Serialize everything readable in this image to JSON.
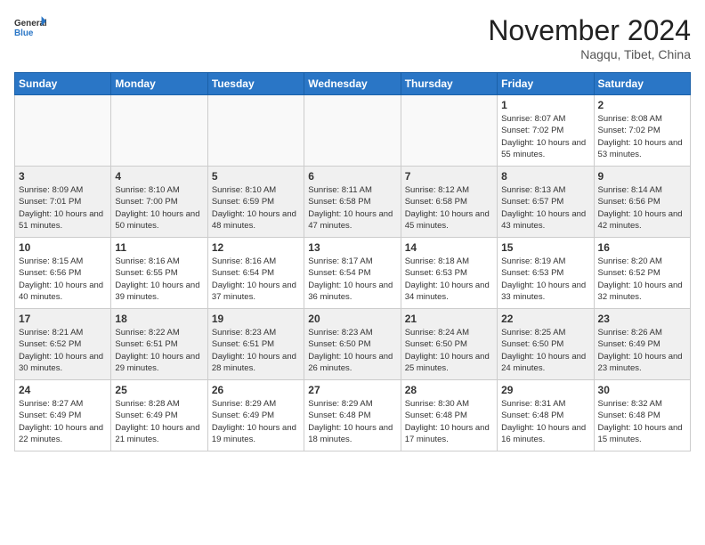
{
  "header": {
    "logo_general": "General",
    "logo_blue": "Blue",
    "month_title": "November 2024",
    "location": "Nagqu, Tibet, China"
  },
  "weekdays": [
    "Sunday",
    "Monday",
    "Tuesday",
    "Wednesday",
    "Thursday",
    "Friday",
    "Saturday"
  ],
  "weeks": [
    [
      {
        "day": "",
        "info": ""
      },
      {
        "day": "",
        "info": ""
      },
      {
        "day": "",
        "info": ""
      },
      {
        "day": "",
        "info": ""
      },
      {
        "day": "",
        "info": ""
      },
      {
        "day": "1",
        "info": "Sunrise: 8:07 AM\nSunset: 7:02 PM\nDaylight: 10 hours and 55 minutes."
      },
      {
        "day": "2",
        "info": "Sunrise: 8:08 AM\nSunset: 7:02 PM\nDaylight: 10 hours and 53 minutes."
      }
    ],
    [
      {
        "day": "3",
        "info": "Sunrise: 8:09 AM\nSunset: 7:01 PM\nDaylight: 10 hours and 51 minutes."
      },
      {
        "day": "4",
        "info": "Sunrise: 8:10 AM\nSunset: 7:00 PM\nDaylight: 10 hours and 50 minutes."
      },
      {
        "day": "5",
        "info": "Sunrise: 8:10 AM\nSunset: 6:59 PM\nDaylight: 10 hours and 48 minutes."
      },
      {
        "day": "6",
        "info": "Sunrise: 8:11 AM\nSunset: 6:58 PM\nDaylight: 10 hours and 47 minutes."
      },
      {
        "day": "7",
        "info": "Sunrise: 8:12 AM\nSunset: 6:58 PM\nDaylight: 10 hours and 45 minutes."
      },
      {
        "day": "8",
        "info": "Sunrise: 8:13 AM\nSunset: 6:57 PM\nDaylight: 10 hours and 43 minutes."
      },
      {
        "day": "9",
        "info": "Sunrise: 8:14 AM\nSunset: 6:56 PM\nDaylight: 10 hours and 42 minutes."
      }
    ],
    [
      {
        "day": "10",
        "info": "Sunrise: 8:15 AM\nSunset: 6:56 PM\nDaylight: 10 hours and 40 minutes."
      },
      {
        "day": "11",
        "info": "Sunrise: 8:16 AM\nSunset: 6:55 PM\nDaylight: 10 hours and 39 minutes."
      },
      {
        "day": "12",
        "info": "Sunrise: 8:16 AM\nSunset: 6:54 PM\nDaylight: 10 hours and 37 minutes."
      },
      {
        "day": "13",
        "info": "Sunrise: 8:17 AM\nSunset: 6:54 PM\nDaylight: 10 hours and 36 minutes."
      },
      {
        "day": "14",
        "info": "Sunrise: 8:18 AM\nSunset: 6:53 PM\nDaylight: 10 hours and 34 minutes."
      },
      {
        "day": "15",
        "info": "Sunrise: 8:19 AM\nSunset: 6:53 PM\nDaylight: 10 hours and 33 minutes."
      },
      {
        "day": "16",
        "info": "Sunrise: 8:20 AM\nSunset: 6:52 PM\nDaylight: 10 hours and 32 minutes."
      }
    ],
    [
      {
        "day": "17",
        "info": "Sunrise: 8:21 AM\nSunset: 6:52 PM\nDaylight: 10 hours and 30 minutes."
      },
      {
        "day": "18",
        "info": "Sunrise: 8:22 AM\nSunset: 6:51 PM\nDaylight: 10 hours and 29 minutes."
      },
      {
        "day": "19",
        "info": "Sunrise: 8:23 AM\nSunset: 6:51 PM\nDaylight: 10 hours and 28 minutes."
      },
      {
        "day": "20",
        "info": "Sunrise: 8:23 AM\nSunset: 6:50 PM\nDaylight: 10 hours and 26 minutes."
      },
      {
        "day": "21",
        "info": "Sunrise: 8:24 AM\nSunset: 6:50 PM\nDaylight: 10 hours and 25 minutes."
      },
      {
        "day": "22",
        "info": "Sunrise: 8:25 AM\nSunset: 6:50 PM\nDaylight: 10 hours and 24 minutes."
      },
      {
        "day": "23",
        "info": "Sunrise: 8:26 AM\nSunset: 6:49 PM\nDaylight: 10 hours and 23 minutes."
      }
    ],
    [
      {
        "day": "24",
        "info": "Sunrise: 8:27 AM\nSunset: 6:49 PM\nDaylight: 10 hours and 22 minutes."
      },
      {
        "day": "25",
        "info": "Sunrise: 8:28 AM\nSunset: 6:49 PM\nDaylight: 10 hours and 21 minutes."
      },
      {
        "day": "26",
        "info": "Sunrise: 8:29 AM\nSunset: 6:49 PM\nDaylight: 10 hours and 19 minutes."
      },
      {
        "day": "27",
        "info": "Sunrise: 8:29 AM\nSunset: 6:48 PM\nDaylight: 10 hours and 18 minutes."
      },
      {
        "day": "28",
        "info": "Sunrise: 8:30 AM\nSunset: 6:48 PM\nDaylight: 10 hours and 17 minutes."
      },
      {
        "day": "29",
        "info": "Sunrise: 8:31 AM\nSunset: 6:48 PM\nDaylight: 10 hours and 16 minutes."
      },
      {
        "day": "30",
        "info": "Sunrise: 8:32 AM\nSunset: 6:48 PM\nDaylight: 10 hours and 15 minutes."
      }
    ]
  ]
}
